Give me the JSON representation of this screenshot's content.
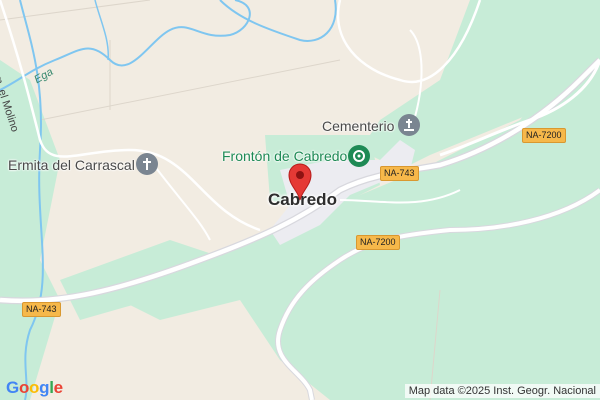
{
  "map": {
    "town": "Cabredo",
    "places": {
      "cemetery": "Cementerio",
      "fronton": "Frontón de Cabredo",
      "hermitage": "Ermita del Carrascal"
    },
    "river": "Ega",
    "street": "Cam. el Molino",
    "roads": [
      "NA-743",
      "NA-7200",
      "NA-743",
      "NA-7200"
    ],
    "pin_color": "#e53935",
    "icons": {
      "cemetery": "cross-grave-icon",
      "fronton": "sports-target-icon",
      "hermitage": "church-cross-icon",
      "pin": "map-pin-icon"
    },
    "colors": {
      "land": "#f2ece2",
      "forest": "#c7ecd7",
      "water": "#7fc6f0",
      "road": "#ffffff",
      "town_area": "#efeff3",
      "road_shield": "#f6b84a"
    }
  },
  "footer": {
    "logo": [
      "G",
      "o",
      "o",
      "g",
      "l",
      "e"
    ],
    "attribution": "Map data ©2025 Inst. Geogr. Nacional"
  }
}
